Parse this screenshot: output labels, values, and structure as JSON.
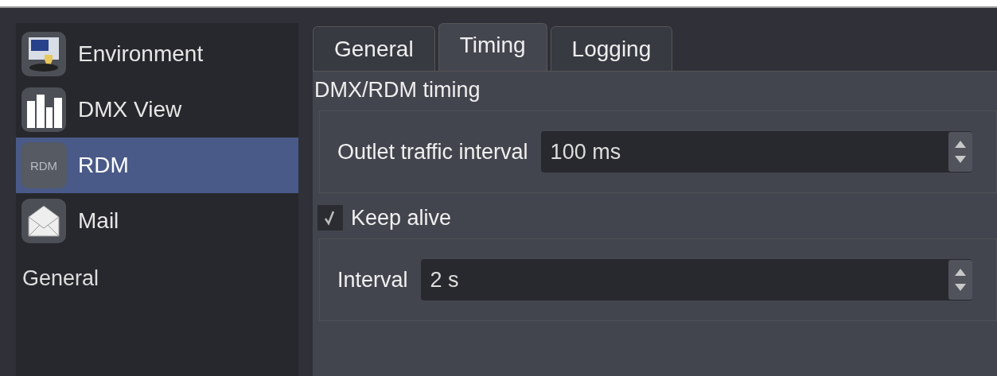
{
  "sidebar": {
    "items": [
      {
        "label": "Environment",
        "kind": "monitor",
        "selected": false
      },
      {
        "label": "DMX View",
        "kind": "bars",
        "selected": false
      },
      {
        "label": "RDM",
        "kind": "text",
        "icon_text": "RDM",
        "selected": true
      },
      {
        "label": "Mail",
        "kind": "mail",
        "selected": false
      }
    ],
    "section_label": "General"
  },
  "tabs": [
    {
      "label": "General",
      "selected": false
    },
    {
      "label": "Timing",
      "selected": true
    },
    {
      "label": "Logging",
      "selected": false
    }
  ],
  "group_title": "DMX/RDM timing",
  "outlet_field": {
    "label": "Outlet traffic interval",
    "value": "100 ms"
  },
  "keep_alive": {
    "label": "Keep alive",
    "checked": true
  },
  "interval_field": {
    "label": "Interval",
    "value": "2 s"
  }
}
